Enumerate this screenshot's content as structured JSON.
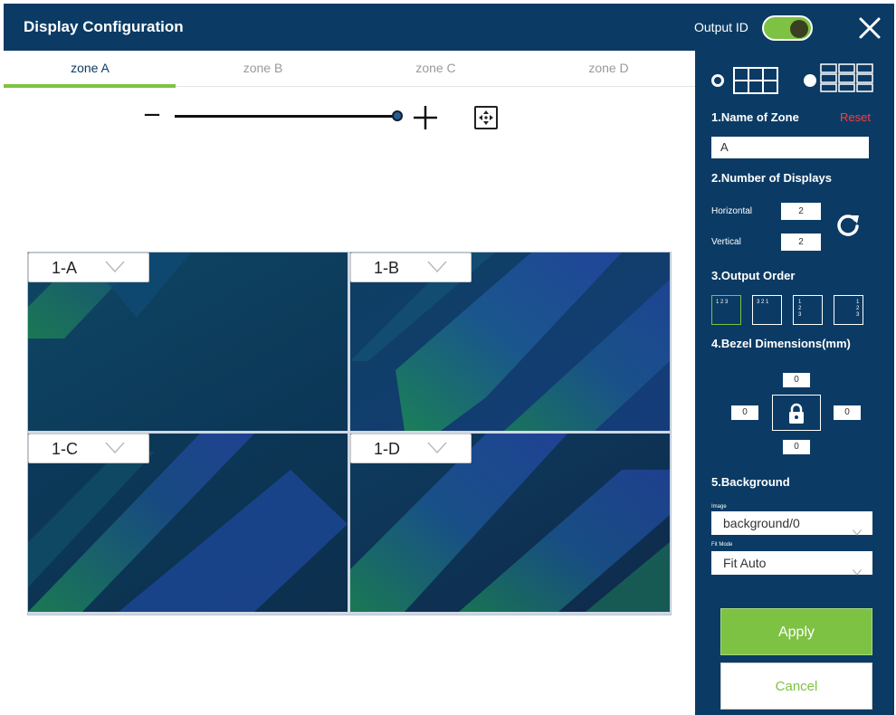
{
  "window": {
    "title": "Display Configuration"
  },
  "header": {
    "output_id_label": "Output ID",
    "output_id_on": true
  },
  "tabs": [
    {
      "label": "zone A",
      "active": true
    },
    {
      "label": "zone B",
      "active": false
    },
    {
      "label": "zone C",
      "active": false
    },
    {
      "label": "zone D",
      "active": false
    }
  ],
  "zoom": {
    "minus": "−",
    "level": 1.0
  },
  "displays": [
    {
      "label": "1-A"
    },
    {
      "label": "1-B"
    },
    {
      "label": "1-C"
    },
    {
      "label": "1-D"
    }
  ],
  "panel": {
    "layout_options": [
      {
        "name": "grid-2x3",
        "selected": true
      },
      {
        "name": "grid-3x3",
        "selected": false
      }
    ],
    "name_section": {
      "title": "1.Name of Zone",
      "reset": "Reset",
      "value": "A"
    },
    "displays_section": {
      "title": "2.Number of Displays",
      "horizontal_label": "Horizontal",
      "horizontal_value": "2",
      "vertical_label": "Vertical",
      "vertical_value": "2"
    },
    "order_section": {
      "title": "3.Output Order",
      "options": [
        {
          "text": "1 2 3"
        },
        {
          "text": "3 2 1"
        },
        {
          "text": "1\n2\n3"
        },
        {
          "text": "1\n2\n3"
        }
      ]
    },
    "bezel_section": {
      "title": "4.Bezel Dimensions(mm)",
      "top": "0",
      "left": "0",
      "right": "0",
      "bottom": "0"
    },
    "background_section": {
      "title": "5.Background",
      "image_label": "Image",
      "image_value": "background/0",
      "fit_label": "Fit Mode",
      "fit_value": "Fit Auto"
    },
    "apply_label": "Apply",
    "cancel_label": "Cancel"
  },
  "colors": {
    "primary": "#0b3b64",
    "accent": "#7dc242",
    "reset": "#ff3b3b"
  }
}
